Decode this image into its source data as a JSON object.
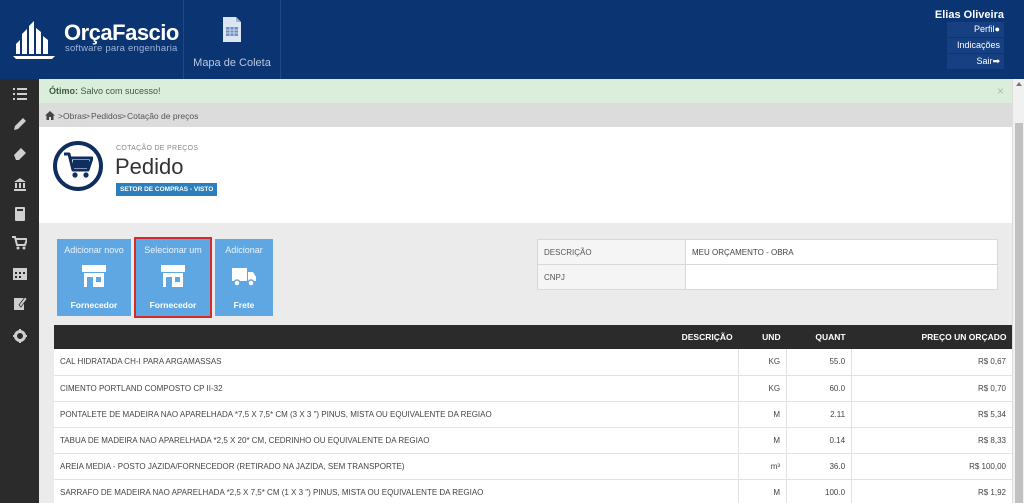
{
  "brand": {
    "name": "OrçaFascio",
    "tagline": "software para engenharia"
  },
  "nav": {
    "items": [
      {
        "label": "Mapa de Coleta",
        "icon": "spreadsheet-icon"
      }
    ]
  },
  "user": {
    "name": "Elias Oliveira",
    "links": [
      {
        "label": "Perfil",
        "icon": "user-icon"
      },
      {
        "label": "Indicações",
        "icon": ""
      },
      {
        "label": "Sair",
        "icon": "logout-icon"
      }
    ]
  },
  "sidebar": {
    "items": [
      {
        "icon": "list-icon"
      },
      {
        "icon": "pencil-icon"
      },
      {
        "icon": "eraser-icon"
      },
      {
        "icon": "bank-icon"
      },
      {
        "icon": "book-icon"
      },
      {
        "icon": "cart-icon"
      },
      {
        "icon": "calendar-icon"
      },
      {
        "icon": "clipboard-icon"
      },
      {
        "icon": "gear-icon"
      }
    ]
  },
  "alert": {
    "strong": "Ótimo:",
    "message": " Salvo com sucesso!",
    "close": "×"
  },
  "breadcrumb": {
    "items": [
      "Obras",
      "Pedidos",
      "Cotação de preços"
    ],
    "separator": ">"
  },
  "header": {
    "eyebrow": "COTAÇÃO DE PREÇOS",
    "title": "Pedido",
    "badge": "SETOR DE COMPRAS - VISTO"
  },
  "actions": [
    {
      "top": "Adicionar novo",
      "bottom": "Fornecedor",
      "icon": "store-icon",
      "selected": false
    },
    {
      "top": "Selecionar um",
      "bottom": "Fornecedor",
      "icon": "store-icon",
      "selected": true
    },
    {
      "top": "Adicionar",
      "bottom": "Frete",
      "icon": "truck-icon",
      "selected": false
    }
  ],
  "info": {
    "rows": [
      {
        "key": "DESCRIÇÃO",
        "value": "MEU ORÇAMENTO - OBRA"
      },
      {
        "key": "CNPJ",
        "value": ""
      }
    ]
  },
  "table": {
    "headers": [
      "DESCRIÇÃO",
      "UND",
      "QUANT",
      "PREÇO UN ORÇADO"
    ],
    "rows": [
      [
        "CAL HIDRATADA CH-I PARA ARGAMASSAS",
        "KG",
        "55.0",
        "R$ 0,67"
      ],
      [
        "CIMENTO PORTLAND COMPOSTO CP II-32",
        "KG",
        "60.0",
        "R$ 0,70"
      ],
      [
        "PONTALETE DE MADEIRA NAO APARELHADA *7,5 X 7,5* CM (3 X 3 \") PINUS, MISTA OU EQUIVALENTE DA REGIAO",
        "M",
        "2.11",
        "R$ 5,34"
      ],
      [
        "TABUA DE MADEIRA NAO APARELHADA *2,5 X 20* CM, CEDRINHO OU EQUIVALENTE DA REGIAO",
        "M",
        "0.14",
        "R$ 8,33"
      ],
      [
        "AREIA MEDIA - POSTO JAZIDA/FORNECEDOR (RETIRADO NA JAZIDA, SEM TRANSPORTE)",
        "m³",
        "36.0",
        "R$ 100,00"
      ],
      [
        "SARRAFO DE MADEIRA NAO APARELHADA *2,5 X 7,5* CM (1 X 3 \") PINUS, MISTA OU EQUIVALENTE DA REGIAO",
        "M",
        "100.0",
        "R$ 1,92"
      ]
    ]
  },
  "colors": {
    "topbar": "#0a3472",
    "sidebar": "#2b2b2b",
    "action_button": "#5fa7e2",
    "selected_outline": "#d42b2b",
    "badge": "#2b7fbc"
  }
}
